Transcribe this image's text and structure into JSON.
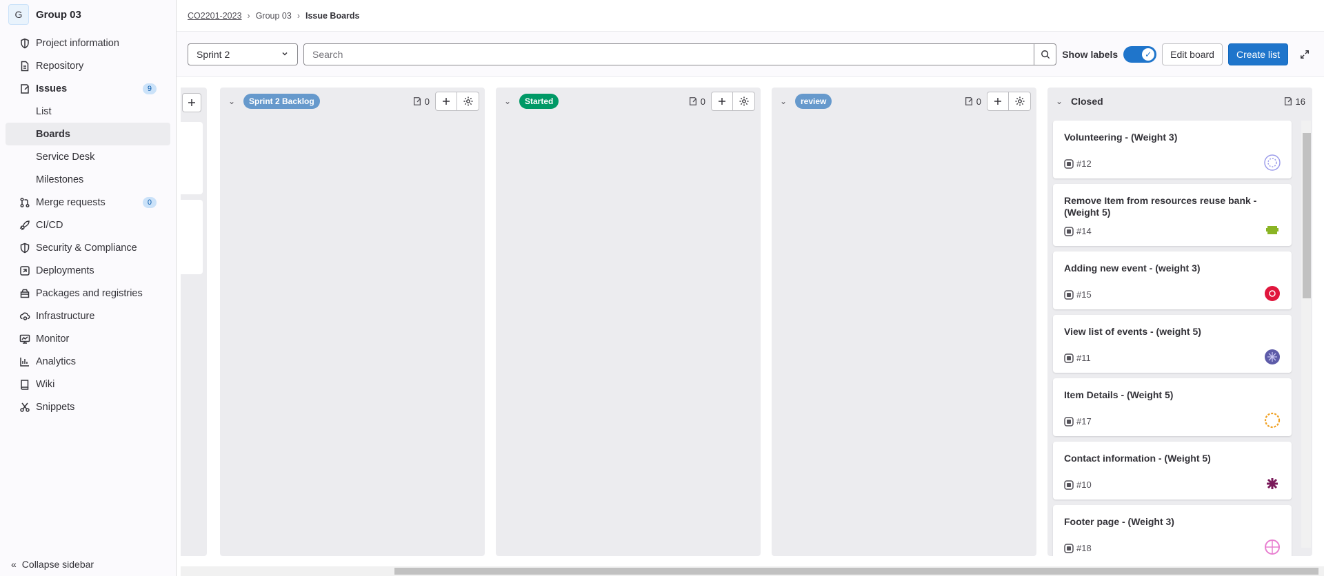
{
  "sidebar": {
    "avatar_letter": "G",
    "group_name": "Group 03",
    "items": [
      {
        "label": "Project information",
        "icon": "project-icon"
      },
      {
        "label": "Repository",
        "icon": "file-icon"
      },
      {
        "label": "Issues",
        "icon": "issues-icon",
        "badge": "9"
      },
      {
        "label": "List"
      },
      {
        "label": "Boards"
      },
      {
        "label": "Service Desk"
      },
      {
        "label": "Milestones"
      },
      {
        "label": "Merge requests",
        "icon": "merge-request-icon",
        "badge": "0"
      },
      {
        "label": "CI/CD",
        "icon": "rocket-icon"
      },
      {
        "label": "Security & Compliance",
        "icon": "shield-icon"
      },
      {
        "label": "Deployments",
        "icon": "deployments-icon"
      },
      {
        "label": "Packages and registries",
        "icon": "package-icon"
      },
      {
        "label": "Infrastructure",
        "icon": "cloud-gear-icon"
      },
      {
        "label": "Monitor",
        "icon": "monitor-icon"
      },
      {
        "label": "Analytics",
        "icon": "chart-icon"
      },
      {
        "label": "Wiki",
        "icon": "book-icon"
      },
      {
        "label": "Snippets",
        "icon": "snippet-icon"
      }
    ],
    "collapse_label": "Collapse sidebar"
  },
  "breadcrumb": {
    "project": "CO2201-2023",
    "group": "Group 03",
    "current": "Issue Boards"
  },
  "filter": {
    "sprint": "Sprint 2",
    "search_placeholder": "Search",
    "show_labels": "Show labels",
    "edit_board": "Edit board",
    "create_list": "Create list"
  },
  "lists": [
    {
      "label": "Sprint 2 Backlog",
      "color": "#6699cc",
      "count": "0"
    },
    {
      "label": "Started",
      "color": "#009966",
      "count": "0"
    },
    {
      "label": "review",
      "color": "#6699cc",
      "count": "0"
    },
    {
      "label": "Closed",
      "count": "16"
    }
  ],
  "closed_cards": [
    {
      "title": "Volunteering - (Weight 3)",
      "ref": "#12",
      "avatar_color": "#9b9bea"
    },
    {
      "title": "Remove Item from resources reuse bank - (Weight 5)",
      "ref": "#14",
      "avatar_color": "#8ab424"
    },
    {
      "title": "Adding new event - (weight 3)",
      "ref": "#15",
      "avatar_color": "#e0163d"
    },
    {
      "title": "View list of events - (weight 5)",
      "ref": "#11",
      "avatar_color": "#5d5ba8"
    },
    {
      "title": "Item Details - (Weight 5)",
      "ref": "#17",
      "avatar_color": "#f0a020"
    },
    {
      "title": "Contact information - (Weight 5)",
      "ref": "#10",
      "avatar_color": "#7a1a5a"
    },
    {
      "title": "Footer page - (Weight 3)",
      "ref": "#18",
      "avatar_color": "#e87fd0"
    }
  ]
}
